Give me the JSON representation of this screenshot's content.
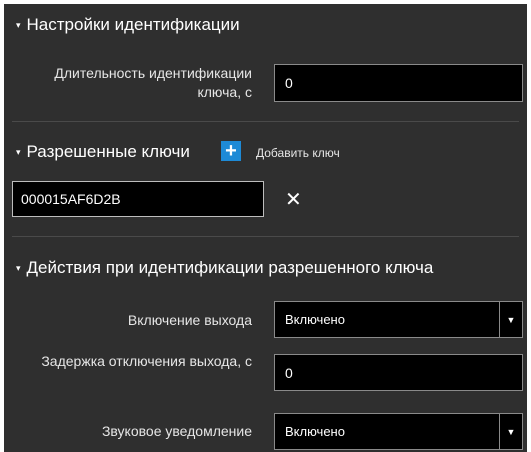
{
  "identification_settings": {
    "title": "Настройки идентификации",
    "duration_label": "Длительность идентификации ключа, с",
    "duration_value": "0"
  },
  "allowed_keys": {
    "title": "Разрешенные ключи",
    "add_label": "Добавить ключ",
    "keys": [
      "000015AF6D2B"
    ]
  },
  "actions": {
    "title": "Действия при идентификации разрешенного ключа",
    "output_label": "Включение выхода",
    "output_value": "Включено",
    "delay_label": "Задержка отключения выхода, с",
    "delay_value": "0",
    "sound_label": "Звуковое уведомление",
    "sound_value": "Включено"
  },
  "colors": {
    "panel_bg": "#2f2f2f",
    "accent": "#1e8ad6",
    "input_bg": "#000000"
  },
  "icons": {
    "bullet": "▾",
    "add": "+",
    "remove": "✕",
    "dropdown": "▼"
  }
}
